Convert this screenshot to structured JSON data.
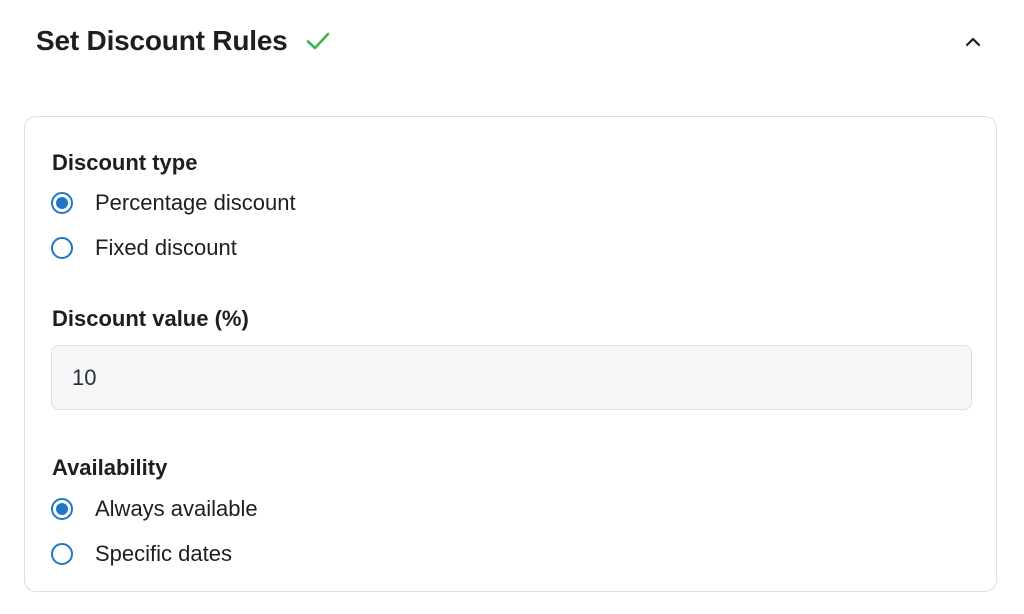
{
  "header": {
    "title": "Set Discount Rules",
    "status_icon": "check-icon",
    "status_color": "#3cb44b",
    "collapse_icon": "chevron-up-icon"
  },
  "discount_type": {
    "label": "Discount type",
    "options": [
      {
        "label": "Percentage discount",
        "selected": true
      },
      {
        "label": "Fixed discount",
        "selected": false
      }
    ]
  },
  "discount_value": {
    "label": "Discount value (%)",
    "value": "10"
  },
  "availability": {
    "label": "Availability",
    "options": [
      {
        "label": "Always available",
        "selected": true
      },
      {
        "label": "Specific dates",
        "selected": false
      }
    ]
  },
  "colors": {
    "accent": "#1e77c7",
    "border": "#dcdfe3",
    "input_bg": "#f6f7f9"
  }
}
